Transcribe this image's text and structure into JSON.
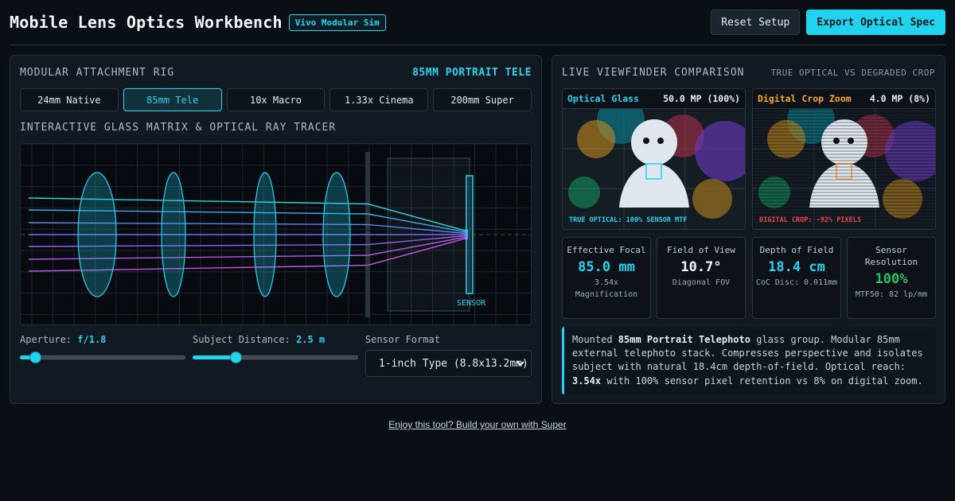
{
  "header": {
    "title": "Mobile Lens Optics Workbench",
    "badge": "Vivo Modular Sim",
    "reset_label": "Reset Setup",
    "export_label": "Export Optical Spec"
  },
  "colors": {
    "accent": "#22d3ee",
    "background": "#0a0f15",
    "warning": "#f5a623",
    "success": "#22c55e",
    "degraded": "#ef4444"
  },
  "rig": {
    "title": "MODULAR ATTACHMENT RIG",
    "active_label": "85MM PORTRAIT TELE",
    "presets": [
      {
        "label": "24mm Native",
        "active": false
      },
      {
        "label": "85mm Tele",
        "active": true
      },
      {
        "label": "10x Macro",
        "active": false
      },
      {
        "label": "1.33x Cinema",
        "active": false
      },
      {
        "label": "200mm Super",
        "active": false
      }
    ]
  },
  "tracer": {
    "title": "INTERACTIVE GLASS MATRIX & OPTICAL RAY TRACER",
    "sensor_label": "SENSOR"
  },
  "controls": {
    "aperture": {
      "label": "Aperture:",
      "value": "f/1.8",
      "level": 0.09
    },
    "distance": {
      "label": "Subject Distance:",
      "value": "2.5 m",
      "level": 0.26
    },
    "sensor": {
      "label": "Sensor Format",
      "selected": "1-inch Type (8.8x13.2mm)"
    }
  },
  "viewfinder": {
    "title": "LIVE VIEWFINDER COMPARISON",
    "subtitle": "TRUE OPTICAL VS DEGRADED CROP",
    "optical": {
      "label": "Optical Glass",
      "mp": "50.0 MP (100%)",
      "caption": "TRUE OPTICAL: 100% SENSOR MTF"
    },
    "digital": {
      "label": "Digital Crop Zoom",
      "mp": "4.0 MP (8%)",
      "caption": "DIGITAL CROP: -92% PIXELS"
    }
  },
  "stats": [
    {
      "label": "Effective Focal",
      "value": "85.0 mm",
      "sub": "3.54x Magnification",
      "color": "#22d3ee"
    },
    {
      "label": "Field of View",
      "value": "10.7°",
      "sub": "Diagonal FOV",
      "color": "#f2f6f9"
    },
    {
      "label": "Depth of Field",
      "value": "18.4 cm",
      "sub": "CoC Disc: 0.011mm",
      "color": "#22d3ee"
    },
    {
      "label": "Sensor Resolution",
      "value": "100%",
      "sub": "MTF50: 82 lp/mm",
      "color": "#22c55e"
    }
  ],
  "description": {
    "prefix": "Mounted ",
    "lens_name": "85mm Portrait Telephoto",
    "middle": " glass group. Modular 85mm external telephoto stack. Compresses perspective and isolates subject with natural 18.4cm depth-of-field. Optical reach: ",
    "reach": "3.54x",
    "suffix": " with 100% sensor pixel retention vs 8% on digital zoom."
  },
  "footer": {
    "link": "Enjoy this tool? Build your own with Super"
  }
}
